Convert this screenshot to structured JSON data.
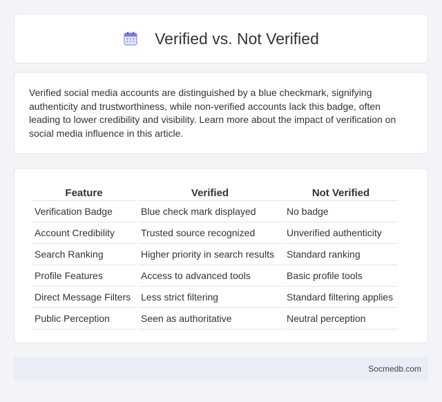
{
  "header": {
    "title": "Verified vs. Not Verified",
    "icon": "calendar-icon"
  },
  "description": {
    "text": "Verified social media accounts are distinguished by a blue checkmark, signifying authenticity and trustworthiness, while non-verified accounts lack this badge, often leading to lower credibility and visibility. Learn more about the impact of verification on social media influence in this article."
  },
  "table": {
    "headers": [
      "Feature",
      "Verified",
      "Not Verified"
    ],
    "rows": [
      [
        "Verification Badge",
        "Blue check mark displayed",
        "No badge"
      ],
      [
        "Account Credibility",
        "Trusted source recognized",
        "Unverified authenticity"
      ],
      [
        "Search Ranking",
        "Higher priority in search results",
        "Standard ranking"
      ],
      [
        "Profile Features",
        "Access to advanced tools",
        "Basic profile tools"
      ],
      [
        "Direct Message Filters",
        "Less strict filtering",
        "Standard filtering applies"
      ],
      [
        "Public Perception",
        "Seen as authoritative",
        "Neutral perception"
      ]
    ]
  },
  "footer": {
    "site": "Socmedb.com"
  },
  "colors": {
    "background": "#f2f4f8",
    "card": "#ffffff",
    "footer": "#e8edf6",
    "icon_accent": "#7b7fe0"
  }
}
